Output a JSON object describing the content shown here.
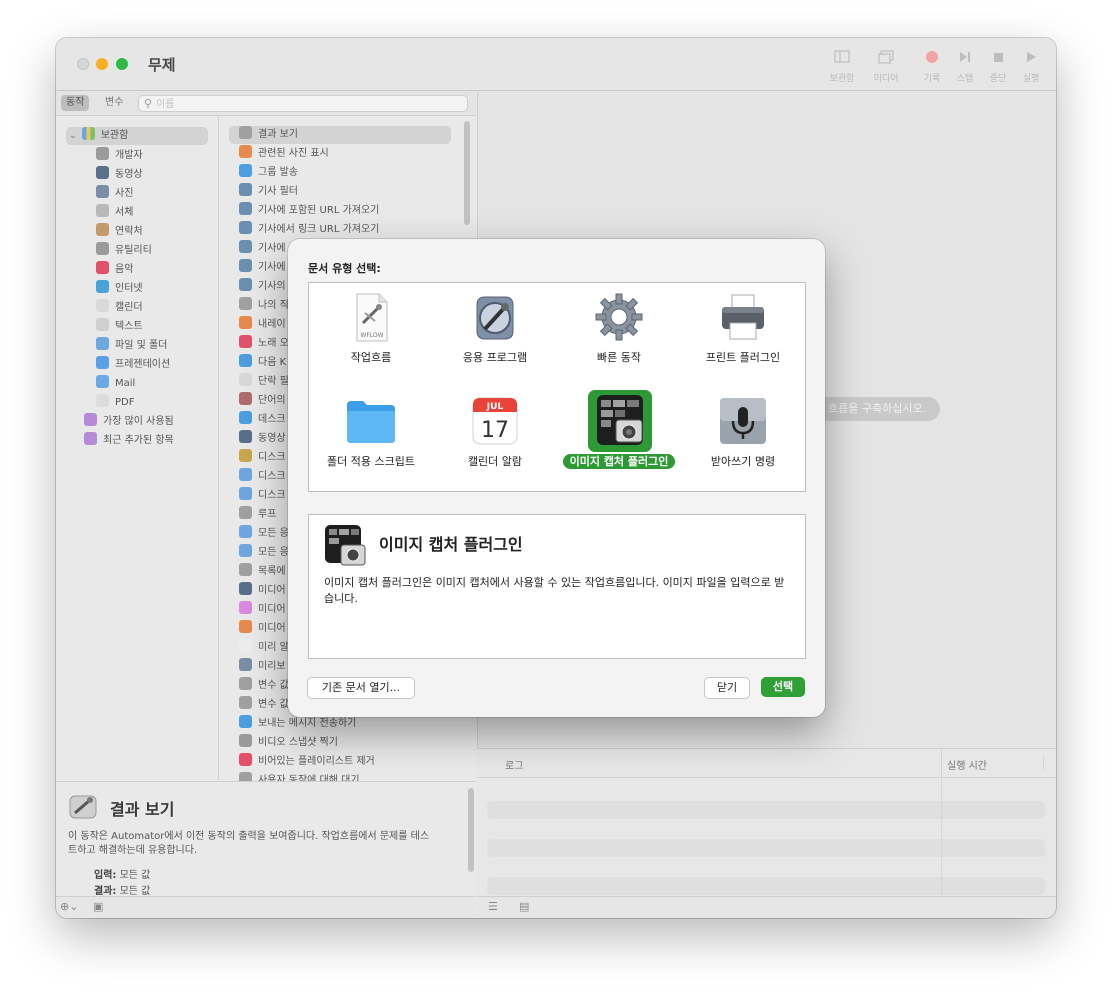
{
  "window": {
    "title": "무제"
  },
  "toolbar": {
    "library_label": "보관함",
    "media_label": "미디어",
    "record_label": "기록",
    "step_label": "스텝",
    "stop_label": "중단",
    "run_label": "실행"
  },
  "left": {
    "tab_actions": "동작",
    "tab_variables": "변수",
    "search_placeholder": "이름"
  },
  "library": {
    "root": "보관함",
    "items": [
      "개발자",
      "동영상",
      "사진",
      "서체",
      "연락처",
      "유틸리티",
      "음악",
      "인터넷",
      "캘린더",
      "텍스트",
      "파일 및 폴더",
      "프레젠테이션",
      "Mail",
      "PDF"
    ],
    "smart": [
      "가장 많이 사용됨",
      "최근 추가된 항목"
    ]
  },
  "actions_list": [
    "결과 보기",
    "관련된 사진 표시",
    "그룹 발송",
    "기사 필터",
    "기사에 포함된 URL 가져오기",
    "기사에서 링크 URL 가져오기",
    "기사에",
    "기사에",
    "기사의",
    "나의 직",
    "내레이",
    "노래 오",
    "다음 K",
    "단락 필",
    "단어의",
    "데스크",
    "동영상",
    "디스크",
    "디스크",
    "디스크",
    "루프",
    "모든 응",
    "모든 응",
    "목록에",
    "미디어",
    "미디어",
    "미디어",
    "미리 알",
    "미리보",
    "변수 값",
    "변수 값",
    "보내는 메시지 전송하기",
    "비디오 스냅샷 찍기",
    "비어있는 플레이리스트 제거",
    "사용자 동작에 대해 대기"
  ],
  "canvas": {
    "hint": "흐름을 구축하십시오."
  },
  "log": {
    "col_log": "로그",
    "col_time": "실행 시간"
  },
  "description": {
    "title": "결과 보기",
    "text": "이 동작은 Automator에서 이전 동작의 출력을 보여줍니다. 작업흐름에서 문제를 테스트하고 해결하는데 유용합니다.",
    "input_label": "입력:",
    "input_value": "모든 값",
    "result_label": "결과:",
    "result_value": "모든 값"
  },
  "dialog": {
    "title": "문서 유형 선택:",
    "types": [
      {
        "label": "작업흐름",
        "icon": "workflow-file-icon",
        "badge": "WFLOW"
      },
      {
        "label": "응용 프로그램",
        "icon": "automator-app-icon"
      },
      {
        "label": "빠른 동작",
        "icon": "gear-icon"
      },
      {
        "label": "프린트 플러그인",
        "icon": "printer-icon"
      },
      {
        "label": "폴더 적용 스크립트",
        "icon": "folder-icon"
      },
      {
        "label": "캘린더 알람",
        "icon": "calendar-icon",
        "month": "JUL",
        "day": "17"
      },
      {
        "label": "이미지 캡처 플러그인",
        "icon": "image-capture-icon"
      },
      {
        "label": "받아쓰기 명령",
        "icon": "microphone-icon"
      }
    ],
    "selected_index": 6,
    "info_title": "이미지 캡처 플러그인",
    "info_text": "이미지 캡처 플러그인은 이미지 캡처에서 사용할 수 있는 작업흐름입니다. 이미지 파일을 입력으로 받습니다.",
    "open_existing": "기존 문서 열기...",
    "close": "닫기",
    "choose": "선택"
  },
  "colors": {
    "accent": "#2e9a35",
    "close": "#d7d7d7",
    "minimize": "#f6b022",
    "maximize": "#2dbb43"
  }
}
